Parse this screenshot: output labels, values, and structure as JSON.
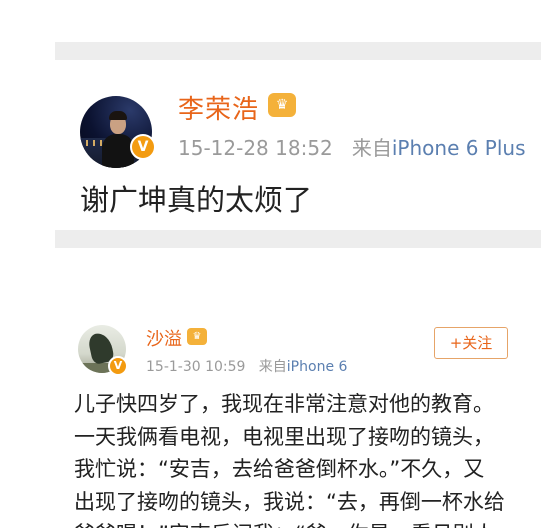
{
  "post1": {
    "username": "李荣浩",
    "timestamp": "15-12-28 18:52",
    "source_prefix": "来自",
    "source_device": "iPhone 6 Plus",
    "text": "谢广坤真的太烦了",
    "verified_icon": "v-verified-badge-icon",
    "member_icon": "crown-member-icon"
  },
  "post2": {
    "username": "沙溢",
    "timestamp": "15-1-30 10:59",
    "source_prefix": "来自",
    "source_device": "iPhone 6",
    "follow_label": "+关注",
    "verified_icon": "v-verified-badge-icon",
    "member_icon": "crown-member-icon",
    "lines": [
      "儿子快四岁了，我现在非常注意对他的教育。",
      "一天我俩看电视，电视里出现了接吻的镜头，",
      "我忙说：“安吉，去给爸爸倒杯水。”不久，又",
      "出现了接吻的镜头，我说：“去，再倒一杯水给",
      "爸爸喝！”安吉反问我：“爸，你是一看见别人"
    ]
  },
  "colors": {
    "username": "#e8651a",
    "meta": "#9a9a9a",
    "source_link": "#5b7fb0",
    "verified_badge": "#f39b10",
    "separator": "#ededed"
  }
}
